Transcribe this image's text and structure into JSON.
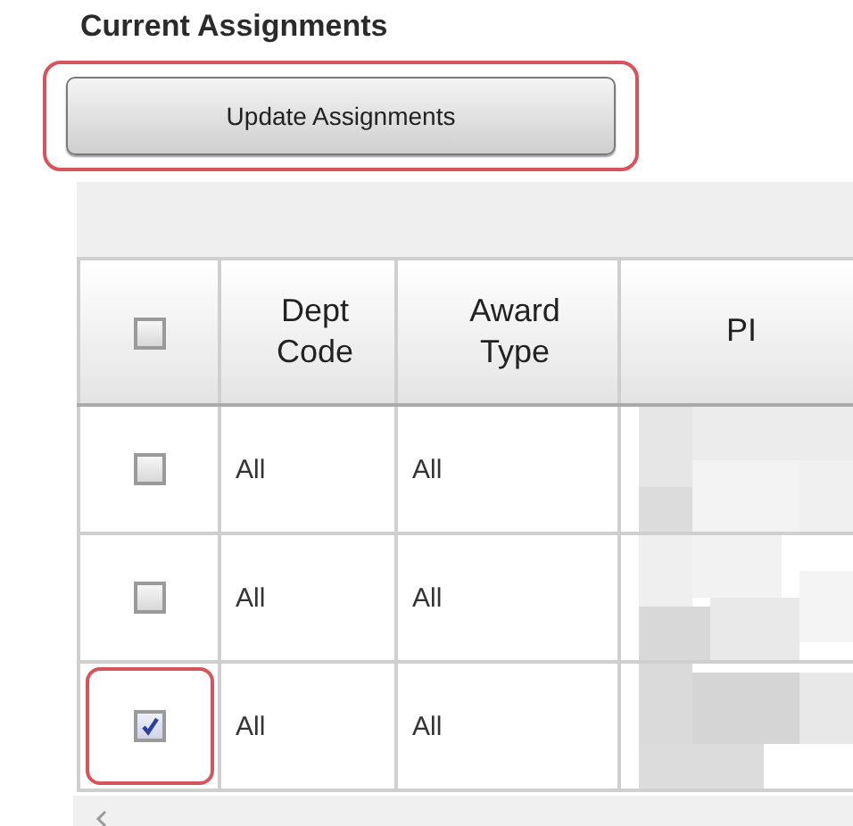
{
  "title": "Current Assignments",
  "update_button": {
    "label": "Update Assignments",
    "highlighted": true
  },
  "table": {
    "select_all": {
      "checked": false
    },
    "columns": [
      {
        "label": "Dept\nCode"
      },
      {
        "label": "Award\nType"
      },
      {
        "label": "PI"
      }
    ],
    "rows": [
      {
        "checked": false,
        "highlighted": false,
        "dept_code": "All",
        "award_type": "All"
      },
      {
        "checked": false,
        "highlighted": false,
        "dept_code": "All",
        "award_type": "All"
      },
      {
        "checked": true,
        "highlighted": true,
        "dept_code": "All",
        "award_type": "All"
      }
    ]
  }
}
